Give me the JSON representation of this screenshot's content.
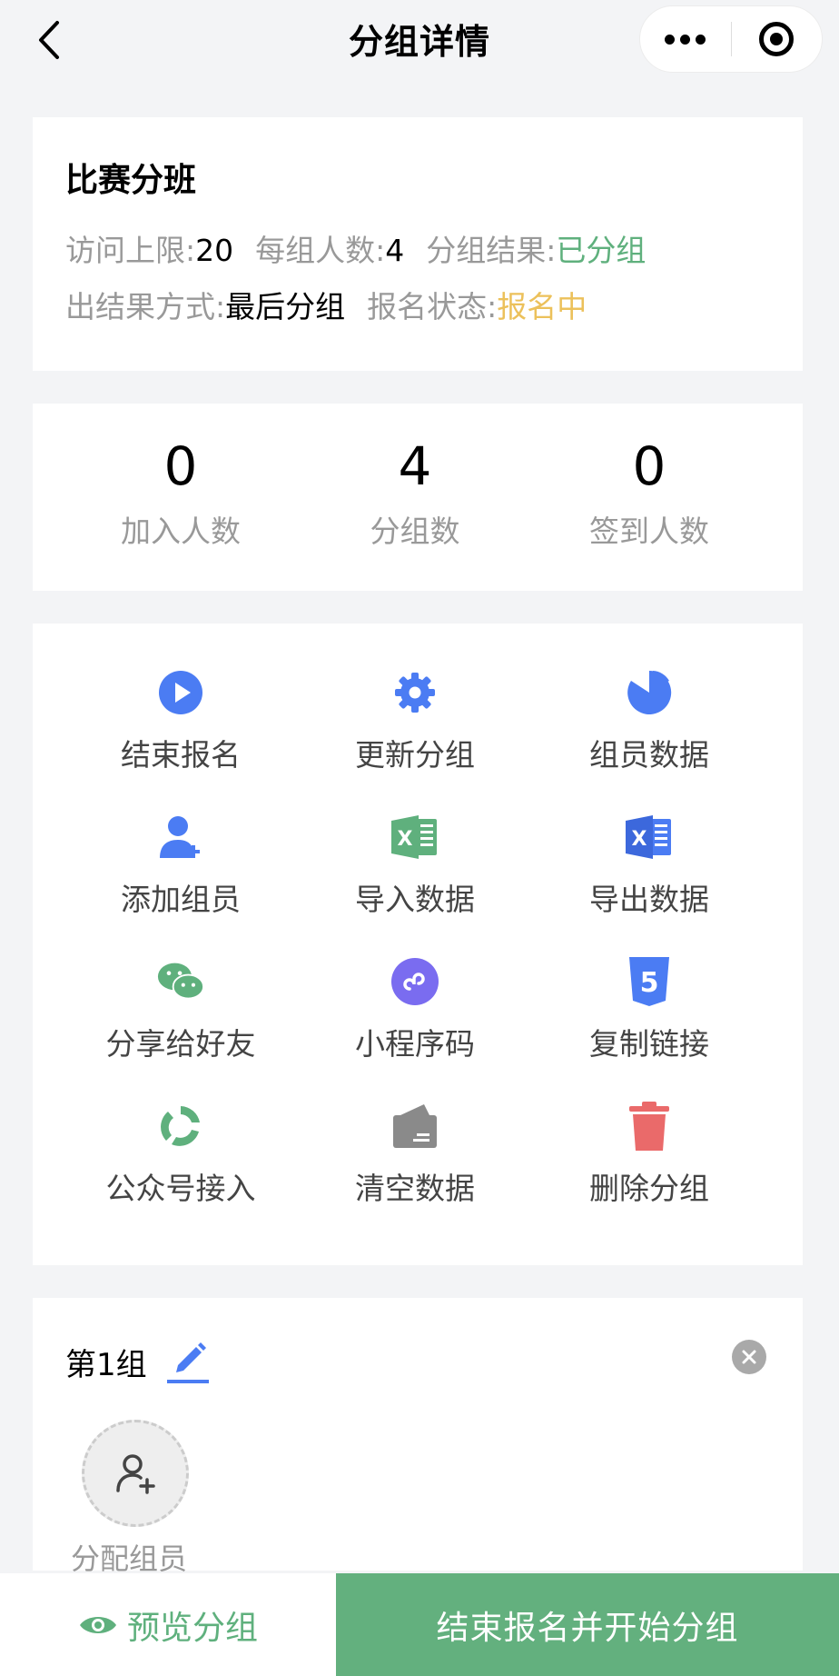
{
  "nav": {
    "title": "分组详情"
  },
  "info": {
    "name": "比赛分班",
    "visit_limit_label": "访问上限:",
    "visit_limit_value": "20",
    "per_group_label": "每组人数:",
    "per_group_value": "4",
    "result_label": "分组结果:",
    "result_value": "已分组",
    "method_label": "出结果方式:",
    "method_value": "最后分组",
    "signup_label": "报名状态:",
    "signup_value": "报名中"
  },
  "stats": [
    {
      "value": "0",
      "label": "加入人数"
    },
    {
      "value": "4",
      "label": "分组数"
    },
    {
      "value": "0",
      "label": "签到人数"
    }
  ],
  "actions": [
    {
      "label": "结束报名",
      "icon": "play-icon"
    },
    {
      "label": "更新分组",
      "icon": "gear-icon"
    },
    {
      "label": "组员数据",
      "icon": "pie-chart-icon"
    },
    {
      "label": "添加组员",
      "icon": "add-user-icon"
    },
    {
      "label": "导入数据",
      "icon": "excel-icon"
    },
    {
      "label": "导出数据",
      "icon": "excel-icon"
    },
    {
      "label": "分享给好友",
      "icon": "wechat-icon"
    },
    {
      "label": "小程序码",
      "icon": "mini-program-icon"
    },
    {
      "label": "复制链接",
      "icon": "html5-icon"
    },
    {
      "label": "公众号接入",
      "icon": "recycle-icon"
    },
    {
      "label": "清空数据",
      "icon": "wallet-icon"
    },
    {
      "label": "删除分组",
      "icon": "trash-icon"
    }
  ],
  "group": {
    "title": "第1组",
    "assign_label": "分配组员"
  },
  "bottom": {
    "preview_label": "预览分组",
    "start_label": "结束报名并开始分组"
  },
  "colors": {
    "blue": "#4b7cf3",
    "green": "#5fb07d",
    "yellow": "#ecc15b",
    "red": "#ea6a6a",
    "purple": "#7a6cf0"
  }
}
